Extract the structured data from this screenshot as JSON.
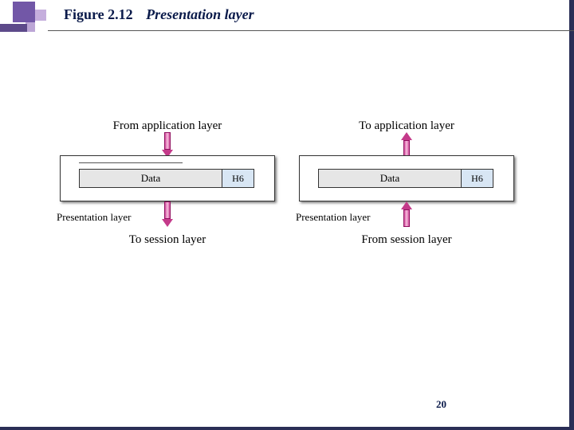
{
  "title": {
    "figure": "Figure 2.12",
    "subject": "Presentation layer"
  },
  "left": {
    "top": "From application layer",
    "data": "Data",
    "header": "H6",
    "caption": "Presentation layer",
    "bottom": "To session layer"
  },
  "right": {
    "top": "To application layer",
    "data": "Data",
    "header": "H6",
    "caption": "Presentation layer",
    "bottom": "From session layer"
  },
  "page": "20"
}
